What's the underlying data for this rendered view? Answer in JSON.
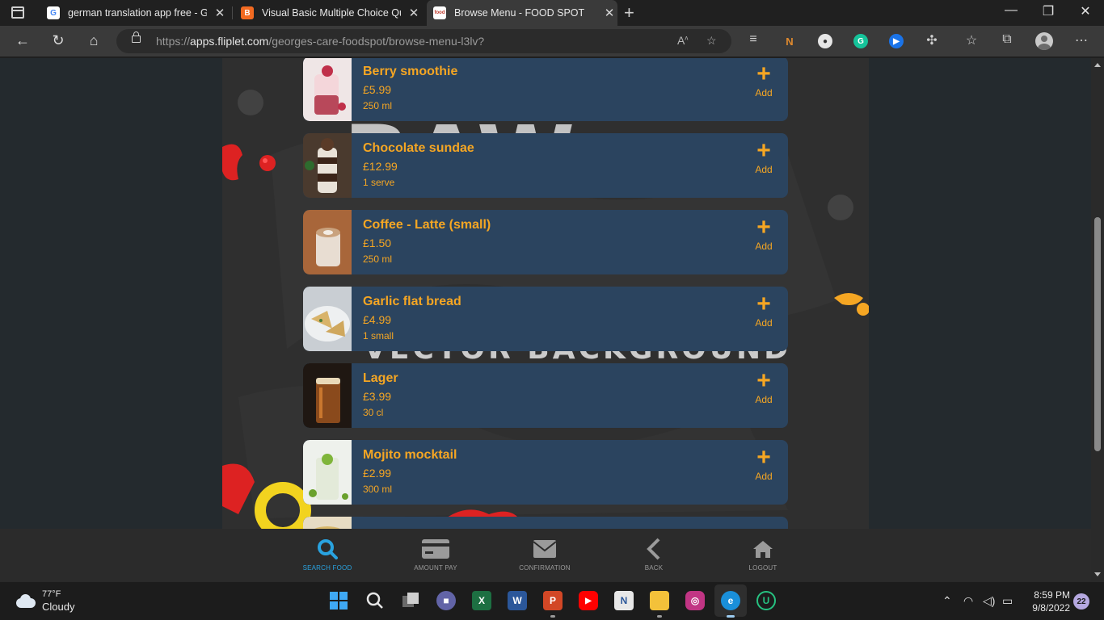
{
  "browser": {
    "tabs": [
      {
        "title": "german translation app free - Go",
        "favicon": "google-icon",
        "active": false
      },
      {
        "title": "Visual Basic Multiple Choice Que",
        "favicon": "blogger-icon",
        "active": false
      },
      {
        "title": "Browse Menu - FOOD SPOT",
        "favicon": "foodspot-icon",
        "active": true
      }
    ],
    "url_prefix": "https://",
    "url_host": "apps.fliplet.com",
    "url_path": "/georges-care-foodspot/browse-menu-l3lv?"
  },
  "menu": {
    "items": [
      {
        "name": "Berry smoothie",
        "price": "£5.99",
        "size": "250 ml",
        "add_label": "Add",
        "image": "berry-smoothie"
      },
      {
        "name": "Chocolate sundae",
        "price": "£12.99",
        "size": "1 serve",
        "add_label": "Add",
        "image": "chocolate-sundae"
      },
      {
        "name": "Coffee - Latte (small)",
        "price": "£1.50",
        "size": "250 ml",
        "add_label": "Add",
        "image": "coffee-latte"
      },
      {
        "name": "Garlic flat bread",
        "price": "£4.99",
        "size": "1 small",
        "add_label": "Add",
        "image": "garlic-flat-bread"
      },
      {
        "name": "Lager",
        "price": "£3.99",
        "size": "30 cl",
        "add_label": "Add",
        "image": "lager"
      },
      {
        "name": "Mojito mocktail",
        "price": "£2.99",
        "size": "300 ml",
        "add_label": "Add",
        "image": "mojito-mocktail"
      }
    ]
  },
  "bottom_nav": [
    {
      "label": "SEARCH FOOD",
      "icon": "search-icon",
      "active": true
    },
    {
      "label": "AMOUNT PAY",
      "icon": "credit-card-icon",
      "active": false
    },
    {
      "label": "CONFIRMATION",
      "icon": "envelope-icon",
      "active": false
    },
    {
      "label": "BACK",
      "icon": "chevron-left-icon",
      "active": false
    },
    {
      "label": "LOGOUT",
      "icon": "home-icon",
      "active": false
    }
  ],
  "background_text": "VECTOR BACKGROUND",
  "taskbar": {
    "temperature": "77°F",
    "condition": "Cloudy",
    "time": "8:59 PM",
    "date": "9/8/2022",
    "notifications": "22"
  },
  "colors": {
    "accent": "#f5a623",
    "card": "#2b445f",
    "nav_active": "#29a3e0"
  }
}
